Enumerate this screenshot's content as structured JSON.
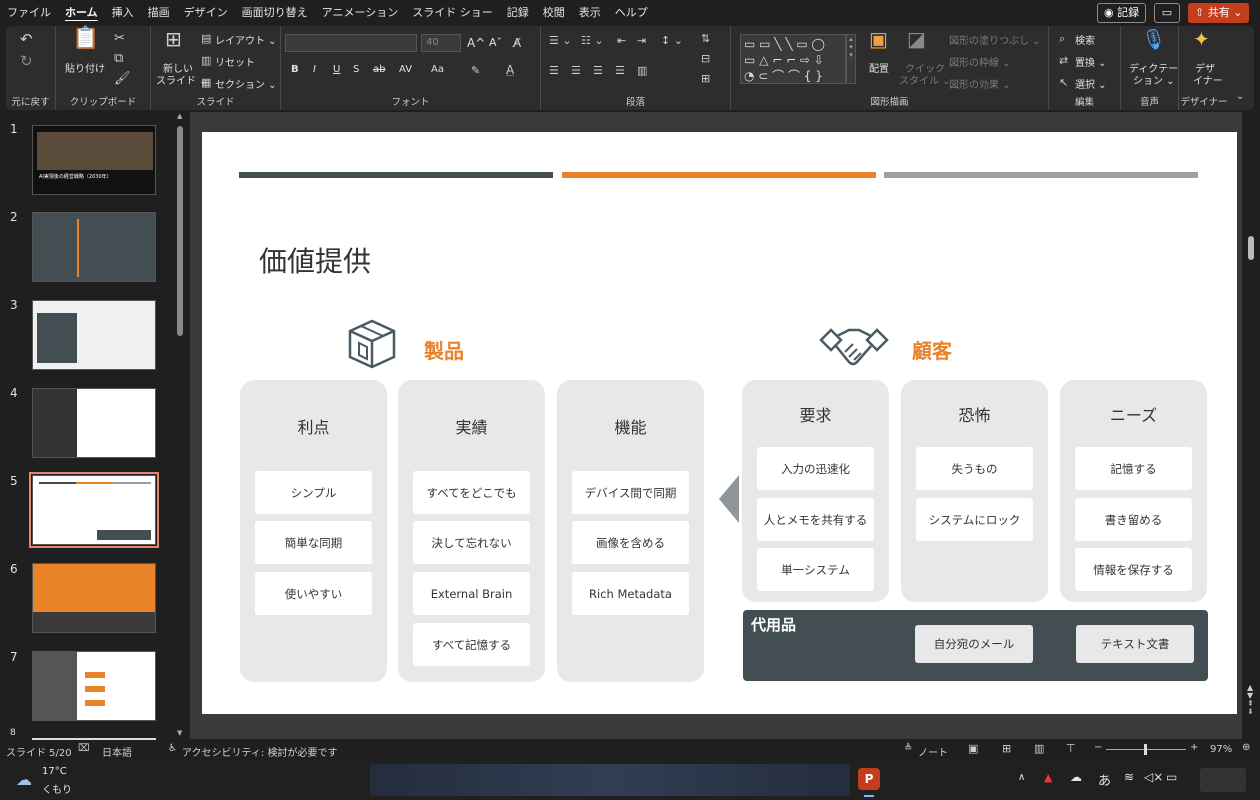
{
  "menubar": {
    "items": [
      "ファイル",
      "ホーム",
      "挿入",
      "描画",
      "デザイン",
      "画面切り替え",
      "アニメーション",
      "スライド ショー",
      "記録",
      "校閲",
      "表示",
      "ヘルプ"
    ],
    "record_btn": "◉ 記録",
    "share_btn": "⇧ 共有 ⌄"
  },
  "ribbon": {
    "undo": {
      "label": "元に戻す"
    },
    "clipboard": {
      "label": "クリップボード",
      "paste": "貼り付け"
    },
    "slides": {
      "label": "スライド",
      "new_slide": "新しい",
      "new_slide2": "スライド ⌄",
      "layout": "レイアウト ⌄",
      "reset": "リセット",
      "section": "セクション ⌄"
    },
    "font": {
      "label": "フォント",
      "size": "40",
      "bold": "B",
      "italic": "I",
      "underline": "U",
      "shadow": "S",
      "strike": "ab",
      "spacing": "AV",
      "case": "Aa",
      "grow": "A^",
      "shrink": "Aˇ"
    },
    "paragraph": {
      "label": "段落"
    },
    "drawing": {
      "label": "図形描画",
      "arrange": "配置",
      "quick_style": "クイック",
      "quick_style2": "スタイル ⌄",
      "fill": "図形の塗りつぶし ⌄",
      "outline": "図形の枠線 ⌄",
      "effect": "図形の効果 ⌄"
    },
    "editing": {
      "label": "編集",
      "find": "検索",
      "replace": "置換 ⌄",
      "select": "選択 ⌄"
    },
    "voice": {
      "label": "音声",
      "dictate": "ディクテー",
      "dictate2": "ション ⌄"
    },
    "designer": {
      "label": "デザイナー",
      "design": "デザ",
      "design2": "イナー"
    }
  },
  "thumbnails": {
    "numbers": [
      "1",
      "2",
      "3",
      "4",
      "5",
      "6",
      "7",
      "8"
    ],
    "slide1_caption": "AI実現後の経営戦略（2030年）"
  },
  "slide": {
    "title": "価値提供",
    "products": {
      "heading": "製品",
      "columns": [
        {
          "title": "利点",
          "items": [
            "シンプル",
            "簡単な同期",
            "使いやすい"
          ]
        },
        {
          "title": "実績",
          "items": [
            "すべてをどこでも",
            "決して忘れない",
            "External Brain",
            "すべて記憶する"
          ]
        },
        {
          "title": "機能",
          "items": [
            "デバイス間で同期",
            "画像を含める",
            "Rich Metadata"
          ]
        }
      ]
    },
    "customers": {
      "heading": "顧客",
      "columns": [
        {
          "title": "要求",
          "items": [
            "入力の迅速化",
            "人とメモを共有する",
            "単一システム"
          ]
        },
        {
          "title": "恐怖",
          "items": [
            "失うもの",
            "システムにロック"
          ]
        },
        {
          "title": "ニーズ",
          "items": [
            "記憶する",
            "書き留める",
            "情報を保存する"
          ]
        }
      ]
    },
    "substitutes": {
      "label": "代用品",
      "items": [
        "自分宛のメール",
        "テキスト文書"
      ]
    },
    "colors": {
      "dark": "#434e53",
      "orange": "#e8832a",
      "gray": "#9aa1a6",
      "icon": "#4a5a63"
    }
  },
  "statusbar": {
    "slide_pos": "スライド 5/20",
    "language": "日本語",
    "accessibility": "アクセシビリティ: 検討が必要です",
    "notes": "ノート",
    "zoom": "97%"
  },
  "taskbar": {
    "temp": "17°C",
    "weather": "くもり",
    "ime": "あ"
  }
}
